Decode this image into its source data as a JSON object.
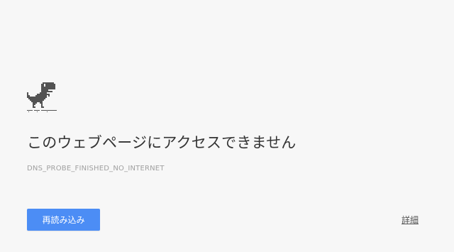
{
  "error_page": {
    "heading": "このウェブページにアクセスできません",
    "error_code": "DNS_PROBE_FINISHED_NO_INTERNET",
    "reload_label": "再読み込み",
    "details_label": "詳細"
  },
  "icons": {
    "dino": "offline-dinosaur-icon"
  },
  "colors": {
    "background": "#f7f7f7",
    "heading_text": "#333333",
    "error_code_text": "#a0a0a0",
    "button_bg": "#4c8df5",
    "button_text": "#ffffff",
    "dino": "#535353"
  }
}
